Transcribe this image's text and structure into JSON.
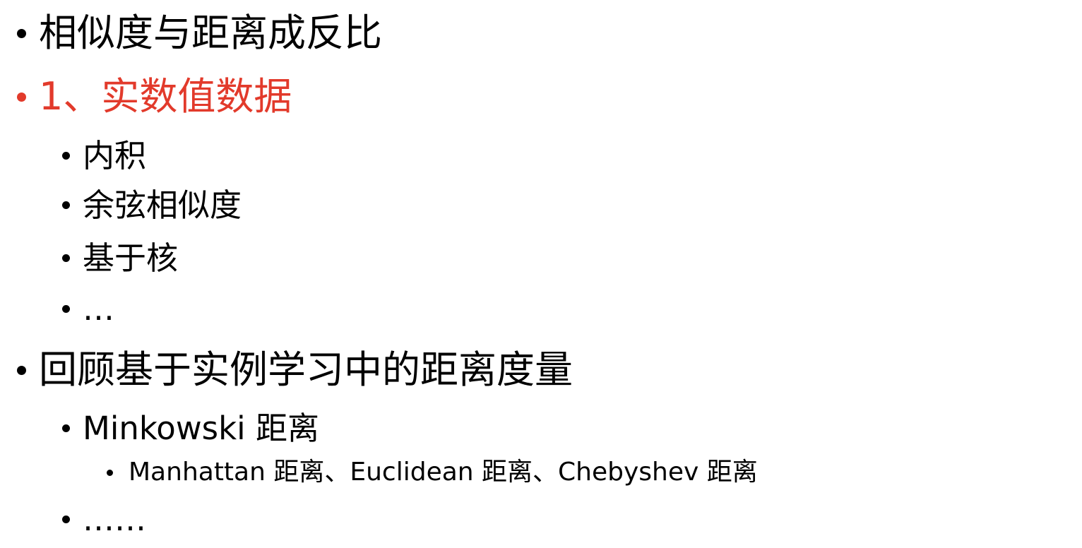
{
  "slide": {
    "items": [
      {
        "level": 1,
        "text": "相似度与距离成反比",
        "color": "#000000"
      },
      {
        "level": 1,
        "text": "1、实数值数据",
        "color": "#e23a2b"
      },
      {
        "level": 2,
        "text": "内积",
        "color": "#000000"
      },
      {
        "level": 2,
        "text": "余弦相似度",
        "color": "#000000"
      },
      {
        "level": 2,
        "text": "基于核",
        "color": "#000000"
      },
      {
        "level": 2,
        "text": "…",
        "color": "#000000"
      },
      {
        "level": 1,
        "text": "回顾基于实例学习中的距离度量",
        "color": "#000000"
      },
      {
        "level": 2,
        "text": "Minkowski 距离",
        "color": "#000000"
      },
      {
        "level": 3,
        "text": "Manhattan 距离、Euclidean 距离、Chebyshev 距离",
        "color": "#000000"
      },
      {
        "level": 2,
        "text": "……",
        "color": "#000000"
      }
    ]
  }
}
